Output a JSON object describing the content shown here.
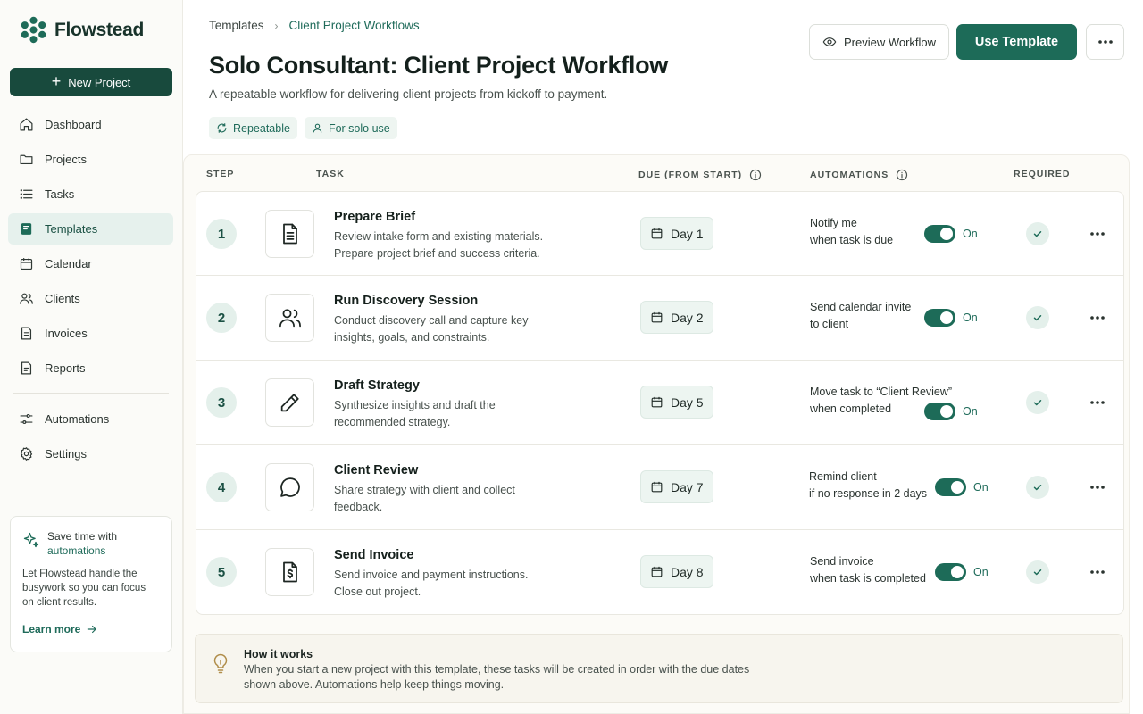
{
  "app": {
    "name": "Flowstead"
  },
  "sidebar": {
    "new_project_label": "New Project",
    "items": [
      {
        "label": "Dashboard",
        "icon": "home-icon"
      },
      {
        "label": "Projects",
        "icon": "folder-icon"
      },
      {
        "label": "Tasks",
        "icon": "list-icon"
      },
      {
        "label": "Templates",
        "icon": "template-icon",
        "active": true
      },
      {
        "label": "Calendar",
        "icon": "calendar-icon"
      },
      {
        "label": "Clients",
        "icon": "users-icon"
      },
      {
        "label": "Invoices",
        "icon": "invoice-icon"
      },
      {
        "label": "Reports",
        "icon": "report-icon"
      },
      {
        "label": "Automations",
        "icon": "sliders-icon"
      },
      {
        "label": "Settings",
        "icon": "gear-icon"
      }
    ],
    "promo": {
      "title": "Save time with",
      "title_accent": "automations",
      "body": "Let Flowstead handle the busywork so you can focus on client results.",
      "link": "Learn more"
    }
  },
  "header": {
    "breadcrumb": {
      "root": "Templates",
      "current": "Client Project Workflows"
    },
    "title": "Solo Consultant: Client Project Workflow",
    "subtitle": "A repeatable workflow for delivering client projects from kickoff to payment.",
    "tags": [
      "Repeatable",
      "For solo use"
    ],
    "preview_label": "Preview Workflow",
    "use_label": "Use Template"
  },
  "table": {
    "columns": {
      "step": "STEP",
      "task": "TASK",
      "due": "DUE (FROM START)",
      "automations": "AUTOMATIONS",
      "required": "REQUIRED"
    },
    "rows": [
      {
        "step": "1",
        "icon": "document-icon",
        "title": "Prepare Brief",
        "desc": "Review intake form and existing materials. Prepare project brief and success criteria.",
        "due": "Day 1",
        "auto_line1": "Notify me",
        "auto_line2": "when task is due",
        "toggle": "On",
        "required": true
      },
      {
        "step": "2",
        "icon": "users-icon",
        "title": "Run Discovery Session",
        "desc": "Conduct discovery call and capture key insights, goals, and constraints.",
        "due": "Day 2",
        "auto_line1": "Send calendar invite",
        "auto_line2": "to client",
        "toggle": "On",
        "required": true
      },
      {
        "step": "3",
        "icon": "pencil-icon",
        "title": "Draft Strategy",
        "desc": "Synthesize insights and draft the recommended strategy.",
        "due": "Day 5",
        "auto_line1": "Move task to “Client Review”",
        "auto_line2": "when completed",
        "toggle": "On",
        "required": true
      },
      {
        "step": "4",
        "icon": "chat-icon",
        "title": "Client Review",
        "desc": "Share strategy with client and collect feedback.",
        "due": "Day 7",
        "auto_line1": "Remind client",
        "auto_line2": "if no response in 2 days",
        "toggle": "On",
        "required": true
      },
      {
        "step": "5",
        "icon": "invoice-dollar-icon",
        "title": "Send Invoice",
        "desc": "Send invoice and payment instructions. Close out project.",
        "due": "Day 8",
        "auto_line1": "Send invoice",
        "auto_line2": "when task is completed",
        "toggle": "On",
        "required": true
      }
    ]
  },
  "how_it_works": {
    "title": "How it works",
    "body": "When you start a new project with this template, these tasks will be created in order with the due dates shown above. Automations help keep things moving."
  },
  "colors": {
    "accent": "#1d6b58",
    "brand_dark": "#184a3d",
    "accent_light": "#e4f0eb"
  }
}
